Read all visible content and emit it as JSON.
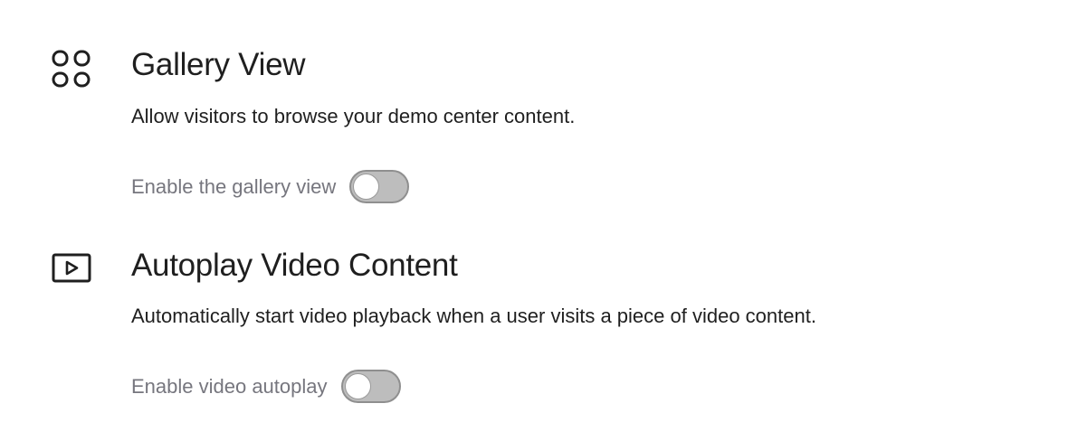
{
  "gallery": {
    "icon": "grid-icon",
    "title": "Gallery View",
    "description": "Allow visitors to browse your demo center content.",
    "toggle_label": "Enable the gallery view",
    "toggle_on": false
  },
  "autoplay": {
    "icon": "video-play-icon",
    "title": "Autoplay Video Content",
    "description": "Automatically start video playback when a user visits a piece of video content.",
    "toggle_label": "Enable video autoplay",
    "toggle_on": false
  },
  "colors": {
    "text": "#1f1f1f",
    "muted_label": "#76767e",
    "toggle_off_track": "#bdbdbd"
  }
}
